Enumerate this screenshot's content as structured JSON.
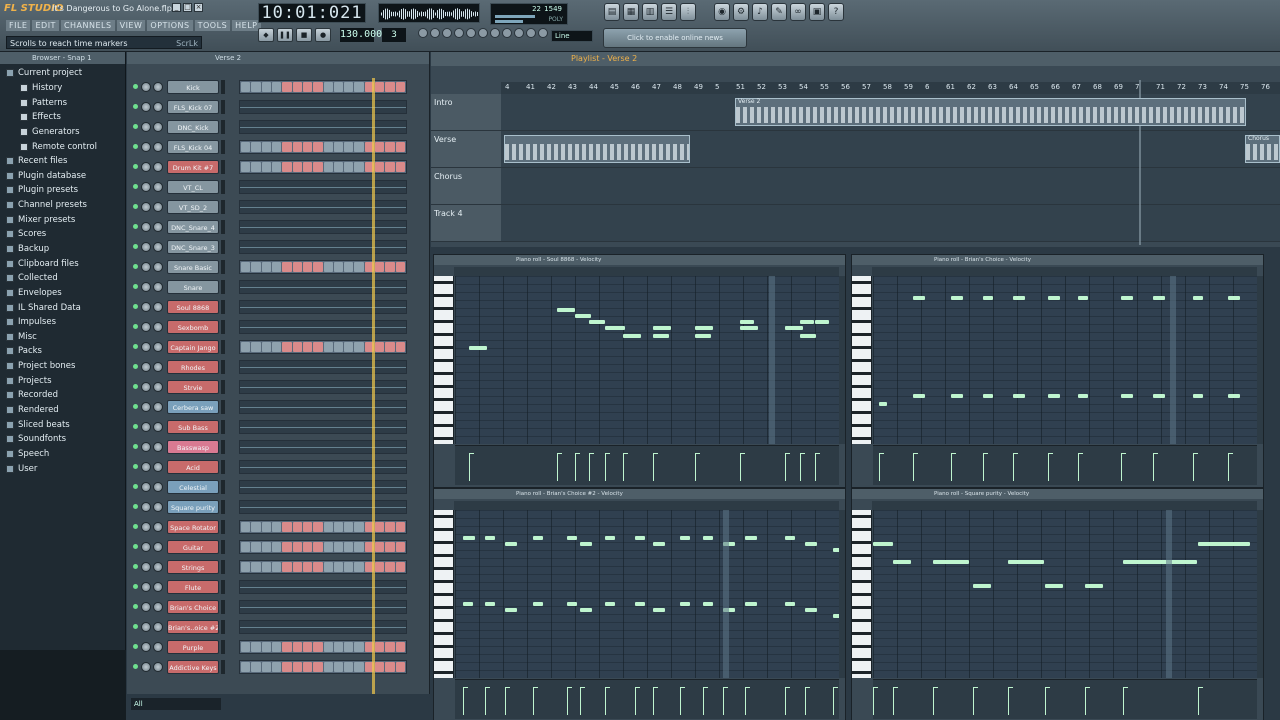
{
  "app": {
    "logo": "FL STUDIO",
    "title": "It's Dangerous to Go Alone.flp",
    "menu": [
      "FILE",
      "EDIT",
      "CHANNELS",
      "VIEW",
      "OPTIONS",
      "TOOLS",
      "HELP"
    ],
    "hint": "Scrolls to reach time markers",
    "hint_right": "ScrLk",
    "time": "10:01:021",
    "tempo": "130.000",
    "pattern": "3",
    "snap": "Line",
    "news": "Click to enable online news",
    "cpu": "22",
    "ram": "1549",
    "poly": "POLY"
  },
  "browser": {
    "header": "Browser - Snap 1",
    "items": [
      {
        "label": "Current project",
        "child": false
      },
      {
        "label": "History",
        "child": true
      },
      {
        "label": "Patterns",
        "child": true
      },
      {
        "label": "Effects",
        "child": true
      },
      {
        "label": "Generators",
        "child": true
      },
      {
        "label": "Remote control",
        "child": true
      },
      {
        "label": "Recent files",
        "child": false
      },
      {
        "label": "Plugin database",
        "child": false
      },
      {
        "label": "Plugin presets",
        "child": false
      },
      {
        "label": "Channel presets",
        "child": false
      },
      {
        "label": "Mixer presets",
        "child": false
      },
      {
        "label": "Scores",
        "child": false
      },
      {
        "label": "Backup",
        "child": false
      },
      {
        "label": "Clipboard files",
        "child": false
      },
      {
        "label": "Collected",
        "child": false
      },
      {
        "label": "Envelopes",
        "child": false
      },
      {
        "label": "IL Shared Data",
        "child": false
      },
      {
        "label": "Impulses",
        "child": false
      },
      {
        "label": "Misc",
        "child": false
      },
      {
        "label": "Packs",
        "child": false
      },
      {
        "label": "Project bones",
        "child": false
      },
      {
        "label": "Projects",
        "child": false
      },
      {
        "label": "Recorded",
        "child": false
      },
      {
        "label": "Rendered",
        "child": false
      },
      {
        "label": "Sliced beats",
        "child": false
      },
      {
        "label": "Soundfonts",
        "child": false
      },
      {
        "label": "Speech",
        "child": false
      },
      {
        "label": "User",
        "child": false
      }
    ]
  },
  "stepseq": {
    "header": "Verse 2",
    "filter": "All",
    "channels": [
      {
        "name": "Kick",
        "color": "default",
        "mode": "steps"
      },
      {
        "name": "FLS_Kick 07",
        "color": "default",
        "mode": "roll"
      },
      {
        "name": "DNC_Kick",
        "color": "default",
        "mode": "roll"
      },
      {
        "name": "FLS_Kick 04",
        "color": "default",
        "mode": "steps"
      },
      {
        "name": "Drum Kit #7",
        "color": "red",
        "mode": "steps"
      },
      {
        "name": "VT_CL",
        "color": "default",
        "mode": "roll"
      },
      {
        "name": "VT_SD_2",
        "color": "default",
        "mode": "roll"
      },
      {
        "name": "DNC_Snare_4",
        "color": "default",
        "mode": "roll"
      },
      {
        "name": "DNC_Snare_3",
        "color": "default",
        "mode": "roll"
      },
      {
        "name": "Snare Basic",
        "color": "default",
        "mode": "steps"
      },
      {
        "name": "Snare",
        "color": "default",
        "mode": "roll"
      },
      {
        "name": "Soul 8868",
        "color": "red",
        "mode": "roll"
      },
      {
        "name": "Sexbomb",
        "color": "red",
        "mode": "roll"
      },
      {
        "name": "Captain Jango",
        "color": "red",
        "mode": "steps"
      },
      {
        "name": "Rhodes",
        "color": "red",
        "mode": "roll"
      },
      {
        "name": "Strvie",
        "color": "red",
        "mode": "roll"
      },
      {
        "name": "Cerbera saw",
        "color": "blue",
        "mode": "roll"
      },
      {
        "name": "Sub Bass",
        "color": "red",
        "mode": "roll"
      },
      {
        "name": "Basswasp",
        "color": "pink",
        "mode": "roll"
      },
      {
        "name": "Acid",
        "color": "red",
        "mode": "roll"
      },
      {
        "name": "Celestial",
        "color": "blue",
        "mode": "roll"
      },
      {
        "name": "Square purity",
        "color": "blue",
        "mode": "roll"
      },
      {
        "name": "Space Rotator",
        "color": "red",
        "mode": "steps"
      },
      {
        "name": "Guitar",
        "color": "red",
        "mode": "steps"
      },
      {
        "name": "Strings",
        "color": "red",
        "mode": "steps"
      },
      {
        "name": "Flute",
        "color": "red",
        "mode": "roll"
      },
      {
        "name": "Brian's Choice",
        "color": "red",
        "mode": "roll"
      },
      {
        "name": "Brian's..oice #2",
        "color": "red",
        "mode": "roll"
      },
      {
        "name": "Purple",
        "color": "red",
        "mode": "steps"
      },
      {
        "name": "Addictive Keys",
        "color": "red",
        "mode": "steps"
      }
    ]
  },
  "playlist": {
    "title": "Playlist - Verse 2",
    "ruler": [
      "4",
      "41",
      "42",
      "43",
      "44",
      "45",
      "46",
      "47",
      "48",
      "49",
      "5",
      "51",
      "52",
      "53",
      "54",
      "55",
      "56",
      "57",
      "58",
      "59",
      "6",
      "61",
      "62",
      "63",
      "64",
      "65",
      "66",
      "67",
      "68",
      "69",
      "7",
      "71",
      "72",
      "73",
      "74",
      "75",
      "76"
    ],
    "tracks": [
      {
        "name": "Intro"
      },
      {
        "name": "Verse"
      },
      {
        "name": "Chorus"
      },
      {
        "name": "Track 4"
      }
    ],
    "clips": [
      {
        "track": 1,
        "label": "Verse 2"
      },
      {
        "track": 2,
        "label": ""
      },
      {
        "track": 2,
        "label": "Chorus"
      }
    ]
  },
  "pianorolls": [
    {
      "title": "Piano roll - Soul 8868 - Velocity"
    },
    {
      "title": "Piano roll - Brian's Choice - Velocity"
    },
    {
      "title": "Piano roll - Brian's Choice #2 - Velocity"
    },
    {
      "title": "Piano roll - Square purity - Velocity"
    }
  ],
  "colors": {
    "accent": "#f0b24a",
    "note": "#bff5cf",
    "channel_red": "#c86b6b",
    "channel_blue": "#7aa0bb",
    "channel_pink": "#d97a92"
  }
}
